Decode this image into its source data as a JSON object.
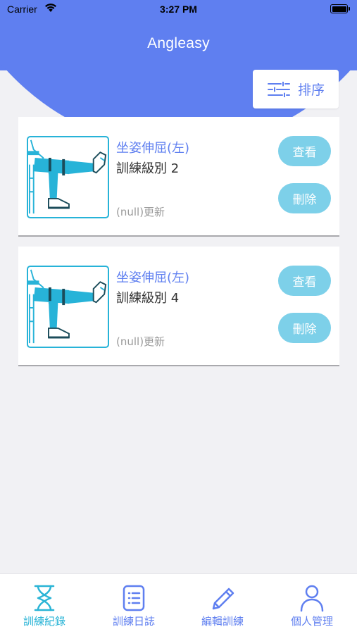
{
  "status_bar": {
    "carrier": "Carrier",
    "time": "3:27 PM"
  },
  "app": {
    "title": "Angleasy",
    "accent_color": "#5f7ff0",
    "pill_color": "#7dd0e9"
  },
  "toolbar": {
    "sort_label": "排序",
    "sort_icon": "sliders-icon"
  },
  "records": [
    {
      "title": "坐姿伸屈(左)",
      "level": "訓練級別 2",
      "updated": "(null)更新",
      "view_label": "查看",
      "delete_label": "刪除",
      "thumbnail": "seated-leg-extension-illustration"
    },
    {
      "title": "坐姿伸屈(左)",
      "level": "訓練級別 4",
      "updated": "(null)更新",
      "view_label": "查看",
      "delete_label": "刪除",
      "thumbnail": "seated-leg-extension-illustration"
    }
  ],
  "tab_bar": {
    "items": [
      {
        "label": "訓練紀錄",
        "icon": "hourglass-icon",
        "active": true
      },
      {
        "label": "訓練日誌",
        "icon": "checklist-icon",
        "active": false
      },
      {
        "label": "編輯訓練",
        "icon": "pencil-icon",
        "active": false
      },
      {
        "label": "個人管理",
        "icon": "person-icon",
        "active": false
      }
    ]
  }
}
